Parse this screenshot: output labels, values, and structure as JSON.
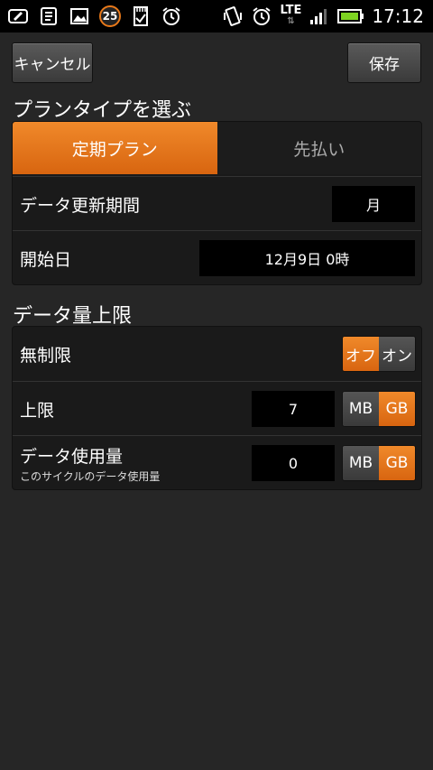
{
  "status_bar": {
    "badge_count": "25",
    "network": "LTE",
    "time": "17:12",
    "icons": [
      "pen-icon",
      "notes-icon",
      "image-icon",
      "count-badge",
      "sd-card-icon",
      "alarm-icon",
      "vibrate-icon",
      "alarm-icon",
      "lte-icon",
      "signal-icon",
      "battery-icon"
    ]
  },
  "header": {
    "cancel_label": "キャンセル",
    "save_label": "保存"
  },
  "plan_section": {
    "title": "プランタイプを選ぶ",
    "tabs": [
      {
        "label": "定期プラン",
        "selected": true
      },
      {
        "label": "先払い",
        "selected": false
      }
    ],
    "rows": [
      {
        "label": "データ更新期間",
        "value": "月"
      },
      {
        "label": "開始日",
        "value": "12月9日 0時"
      }
    ]
  },
  "limit_section": {
    "title": "データ量上限",
    "unlimited": {
      "label": "無制限",
      "off_label": "オフ",
      "on_label": "オン",
      "selected": "オフ"
    },
    "limit": {
      "label": "上限",
      "value": "7",
      "unit_mb": "MB",
      "unit_gb": "GB",
      "selected_unit": "GB"
    },
    "usage": {
      "label": "データ使用量",
      "sublabel": "このサイクルのデータ使用量",
      "value": "0",
      "unit_mb": "MB",
      "unit_gb": "GB",
      "selected_unit": "GB"
    }
  },
  "colors": {
    "accent": "#e8791a",
    "background": "#262626",
    "panel": "#1a1a1a"
  }
}
